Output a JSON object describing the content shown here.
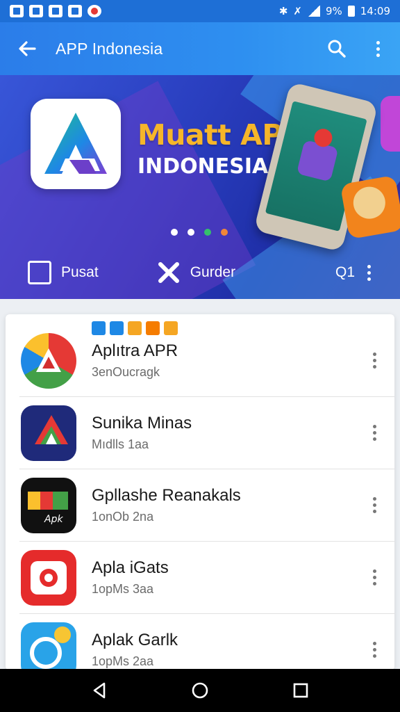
{
  "status_bar": {
    "battery": "9%",
    "time": "14:09"
  },
  "app_bar": {
    "title": "APP Indonesia"
  },
  "banner": {
    "title": "Muatt APK",
    "subtitle": "INDONESIA",
    "nav": {
      "pusat_label": "Pusat",
      "gurder_label": "Gurder",
      "qi_label": "Q1"
    },
    "dot_colors": [
      "#ffffff",
      "#ffffff",
      "#34c16b",
      "#f0873a"
    ]
  },
  "mini_badge_colors": [
    "#1e88e5",
    "#1e88e5",
    "#f5a623",
    "#f57c00",
    "#f5a623"
  ],
  "apps": [
    {
      "name": "Aplıtra APR",
      "subtitle": "3enOucragk",
      "icon": "gradient-a-icon"
    },
    {
      "name": "Sunika Minas",
      "subtitle": "Mıdlls 1aa",
      "icon": "navy-arrow-icon"
    },
    {
      "name": "Gpllashe Reanakals",
      "subtitle": "1onOb 2na",
      "icon": "apk-logo-icon"
    },
    {
      "name": "Apla iGats",
      "subtitle": "1opMs 3aa",
      "icon": "camera-icon"
    },
    {
      "name": "Aplak Garlk",
      "subtitle": "1opMs 2aa",
      "icon": "blue-circle-icon"
    }
  ]
}
